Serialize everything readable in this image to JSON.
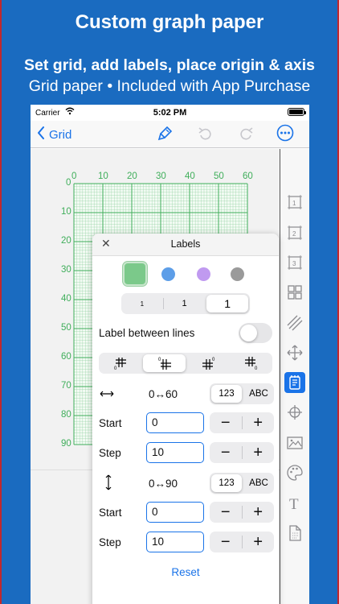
{
  "promo": {
    "title": "Custom graph paper",
    "subtitle_bold": "Set grid, add labels, place origin & axis",
    "subtitle": "Grid paper • Included with App Purchase"
  },
  "status_bar": {
    "carrier": "Carrier",
    "time": "5:02 PM"
  },
  "nav": {
    "back_label": "Grid",
    "icons": [
      "back-chevron-icon",
      "paint-bucket-icon",
      "undo-icon",
      "redo-icon",
      "more-icon"
    ]
  },
  "grid": {
    "x_ticks": [
      "0",
      "10",
      "20",
      "30",
      "40",
      "50",
      "60"
    ],
    "y_ticks": [
      "0",
      "10",
      "20",
      "30",
      "40",
      "50",
      "60",
      "70",
      "80",
      "90"
    ],
    "color": "#3fae5a"
  },
  "panel": {
    "title": "Labels",
    "colors": [
      "#7bc98a",
      "#5d9ee8",
      "#c09af0",
      "#9a9a9a"
    ],
    "selected_color_index": 0,
    "size_options": [
      "1",
      "1",
      "1"
    ],
    "selected_size_index": 2,
    "between_lines_label": "Label between lines",
    "between_lines_on": false,
    "position_icons": [
      "label-bottom-left-icon",
      "label-top-left-icon",
      "label-top-right-icon",
      "label-bottom-right-icon"
    ],
    "selected_position_index": 1,
    "x_axis": {
      "range": "0↔60",
      "format_options": [
        "123",
        "ABC"
      ],
      "selected_format": 0,
      "start_label": "Start",
      "start_value": "0",
      "step_label": "Step",
      "step_value": "10"
    },
    "y_axis": {
      "range": "0↔90",
      "format_options": [
        "123",
        "ABC"
      ],
      "selected_format": 0,
      "start_label": "Start",
      "start_value": "0",
      "step_label": "Step",
      "step_value": "10"
    },
    "minus": "−",
    "plus": "+",
    "reset_label": "Reset"
  },
  "sidebar_tools": [
    "margin-1-icon",
    "margin-2-icon",
    "margin-3-icon",
    "grid-layout-icon",
    "hatch-icon",
    "axis-move-icon",
    "labels-icon",
    "origin-icon",
    "image-icon",
    "palette-icon",
    "text-icon",
    "page-icon"
  ],
  "active_tool": "labels-icon",
  "accent": "#1a73e8",
  "background": "#1a6bc0"
}
